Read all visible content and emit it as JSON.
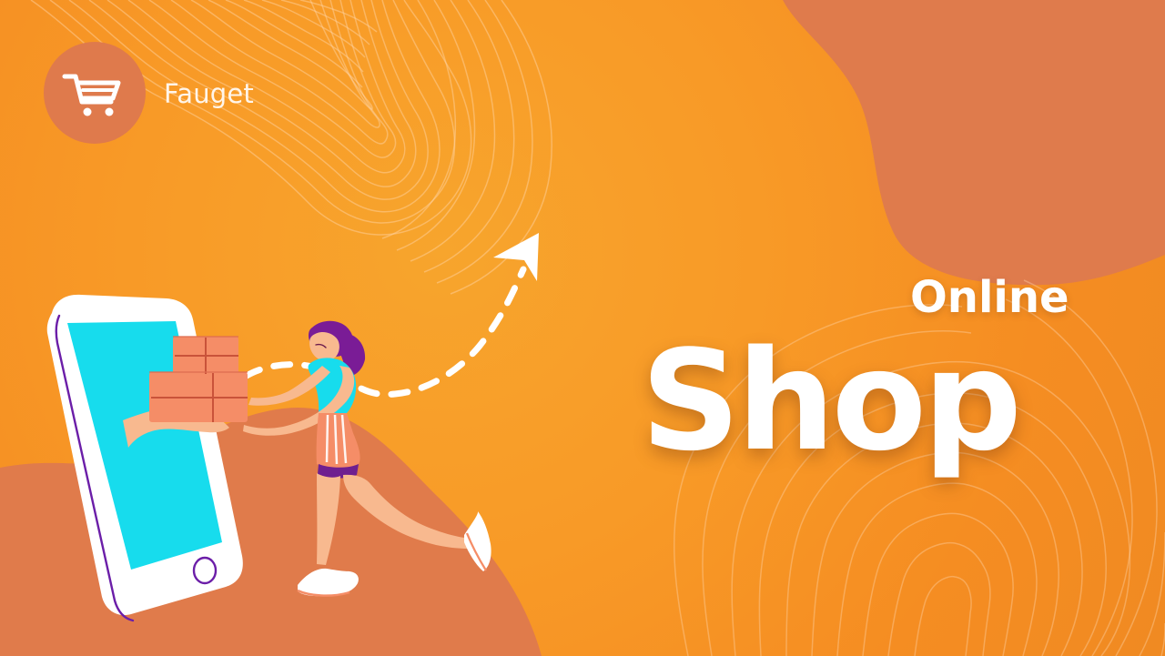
{
  "brand": {
    "name": "Fauget",
    "icon": "cart-icon"
  },
  "headline": {
    "top": "Online",
    "main": "Shop"
  },
  "colors": {
    "background": "#f79a2a",
    "accent_blob": "#df7a4c",
    "phone_screen": "#17dced",
    "text": "#ffffff"
  }
}
